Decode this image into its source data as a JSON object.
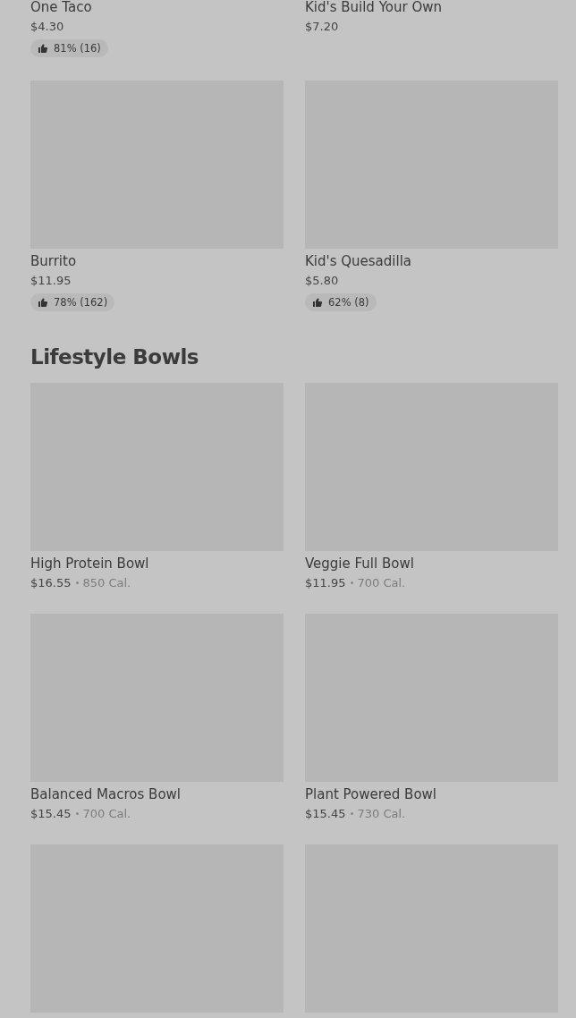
{
  "sections": [
    {
      "items": [
        {
          "kind": "text_only",
          "name": "One Taco",
          "price": "$4.30",
          "rating": "81% (16)"
        },
        {
          "kind": "text_only",
          "name": "Kid's Build Your Own",
          "price": "$7.20"
        },
        {
          "kind": "full",
          "name": "Burrito",
          "price": "$11.95",
          "rating": "78% (162)"
        },
        {
          "kind": "full",
          "name": "Kid's Quesadilla",
          "price": "$5.80",
          "rating": "62% (8)"
        }
      ]
    },
    {
      "title": "Lifestyle Bowls",
      "items": [
        {
          "kind": "full",
          "name": "High Protein Bowl",
          "price": "$16.55",
          "calories": "850 Cal."
        },
        {
          "kind": "full",
          "name": "Veggie Full Bowl",
          "price": "$11.95",
          "calories": "700 Cal."
        },
        {
          "kind": "full",
          "name": "Balanced Macros Bowl",
          "price": "$15.45",
          "calories": "700 Cal."
        },
        {
          "kind": "full",
          "name": "Plant Powered Bowl",
          "price": "$15.45",
          "calories": "730 Cal."
        },
        {
          "kind": "image_only"
        },
        {
          "kind": "image_only"
        }
      ]
    }
  ]
}
